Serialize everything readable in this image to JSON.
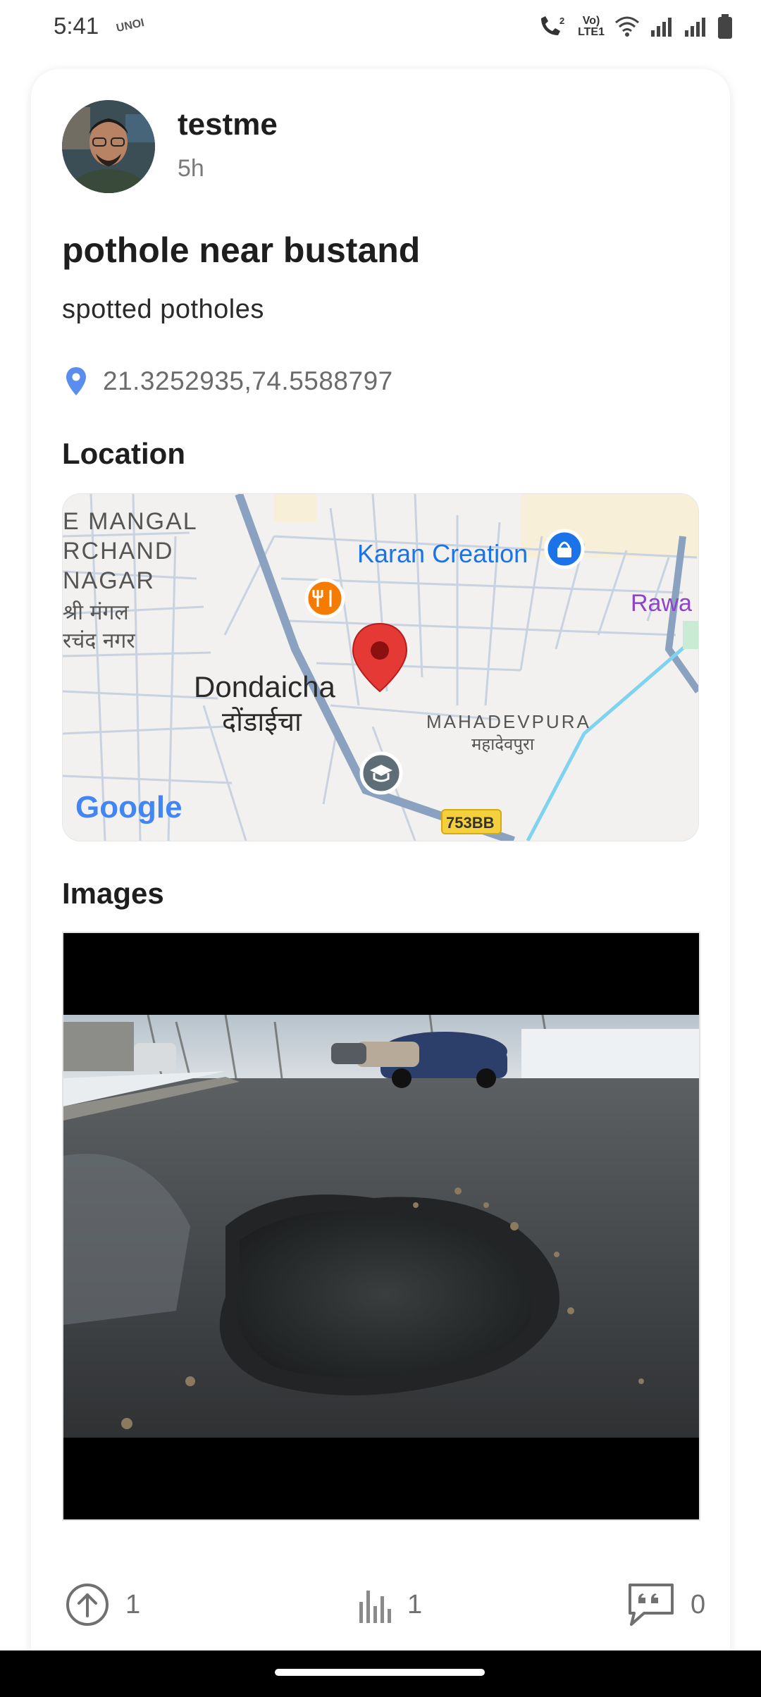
{
  "status_bar": {
    "time": "5:41",
    "carrier_badge": "UNOI",
    "network_label_top": "Vo)",
    "network_label_bottom": "LTE1",
    "icons": [
      "call-signal-icon",
      "volte-icon",
      "wifi-icon",
      "signal-bars-icon",
      "signal-bars-icon",
      "battery-icon"
    ]
  },
  "post": {
    "user_name": "testme",
    "time_ago": "5h",
    "title": "pothole near bustand",
    "description": "spotted potholes",
    "coordinates": "21.3252935,74.5588797"
  },
  "sections": {
    "location_label": "Location",
    "images_label": "Images"
  },
  "map": {
    "labels": {
      "mangal_1": "E MANGAL",
      "mangal_2": "RCHAND",
      "mangal_3": "NAGAR",
      "mangal_hi_1": "श्री मंगल",
      "mangal_hi_2": "रचंद नगर",
      "city": "Dondaicha",
      "city_hi": "दोंडाईचा",
      "poi": "Karan Creation",
      "district": "MAHADEVPURA",
      "district_hi": "महादेवपुरा",
      "rawal": "Rawa",
      "road_badge": "753BB",
      "logo": "Google"
    },
    "colors": {
      "pin": "#e53935",
      "poi_blue": "#1a73e8",
      "food_orange": "#f57c00",
      "school_gray": "#5f6d76",
      "water": "#7fd3f1"
    }
  },
  "actions": {
    "upvote_count": "1",
    "stats_count": "1",
    "comment_count": "0"
  }
}
